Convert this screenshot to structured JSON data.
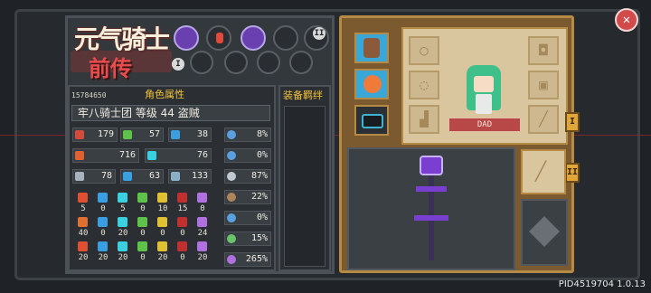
{
  "game": {
    "logo_line1": "元气骑士",
    "logo_line2": "前传",
    "version": "PID4519704 1.0.13"
  },
  "character": {
    "pid": "15784650",
    "attributes_title": "角色属性",
    "name_line": "牢八骑士团 等级 44 盗贼",
    "dad_label": "DAD"
  },
  "skills": {
    "badge_left": "I",
    "badge_right": "II"
  },
  "stats_left": [
    {
      "name": "armor",
      "value": "179",
      "color": "#d44b3b"
    },
    {
      "name": "attack",
      "value": "57",
      "color": "#5fc24a"
    },
    {
      "name": "mana",
      "value": "38",
      "color": "#3a9fe0"
    },
    {
      "name": "hp",
      "value": "716",
      "color": "#e06030"
    },
    {
      "name": "shield",
      "value": "76",
      "color": "#3ad0e0"
    },
    {
      "name": "sword",
      "value": "78",
      "color": "#a9b3bd"
    },
    {
      "name": "staff",
      "value": "63",
      "color": "#3aa0e0"
    },
    {
      "name": "spellbook",
      "value": "133",
      "color": "#8ab0c8"
    }
  ],
  "stats_right": [
    {
      "name": "up-arrow",
      "value": "8%",
      "color": "#5aa0e0"
    },
    {
      "name": "up-arrow",
      "value": "0%",
      "color": "#5aa0e0"
    },
    {
      "name": "crossed-swords",
      "value": "87%",
      "color": "#c0c8d0"
    },
    {
      "name": "boot",
      "value": "22%",
      "color": "#b0835a"
    },
    {
      "name": "clock",
      "value": "0%",
      "color": "#5aa0e0"
    },
    {
      "name": "swirl",
      "value": "15%",
      "color": "#6ac26a"
    },
    {
      "name": "vortex",
      "value": "265%",
      "color": "#b070e0"
    }
  ],
  "resist_rows": [
    {
      "icons": [
        "#e05030",
        "#3a9fe0",
        "#3ad0e0",
        "#5fc24a",
        "#e0c030",
        "#c03030",
        "#b070e0"
      ],
      "values": [
        "5",
        "0",
        "5",
        "0",
        "10",
        "15",
        "0"
      ]
    },
    {
      "icons": [
        "#e07030",
        "#3a9fe0",
        "#3ad0e0",
        "#5fc24a",
        "#e0c030",
        "#c03030",
        "#b070e0"
      ],
      "values": [
        "40",
        "0",
        "20",
        "0",
        "0",
        "0",
        "24"
      ]
    },
    {
      "icons": [
        "#e05030",
        "#3a9fe0",
        "#3ad0e0",
        "#5fc24a",
        "#e0c030",
        "#c03030",
        "#b070e0"
      ],
      "values": [
        "20",
        "20",
        "20",
        "0",
        "20",
        "0",
        "20"
      ]
    }
  ],
  "equipment": {
    "title": "装备羁绊"
  },
  "tabs": {
    "tab_one": "I",
    "tab_two": "II"
  },
  "icons": {
    "close": "close-icon",
    "helmet": "helmet-icon",
    "armor": "armor-icon",
    "sword": "sword-icon",
    "ring": "ring-icon",
    "boot": "boot-icon",
    "amulet": "amulet-icon"
  }
}
